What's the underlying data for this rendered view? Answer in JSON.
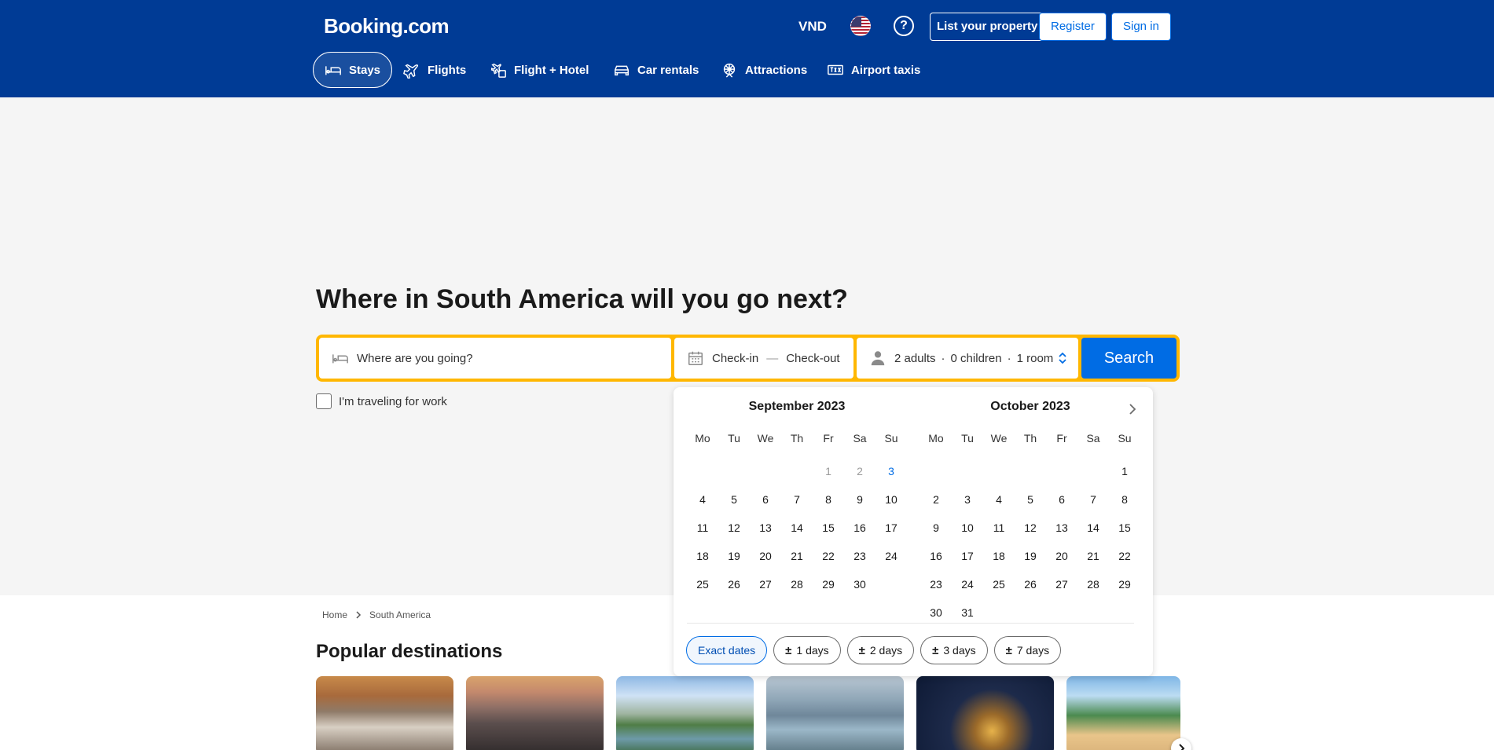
{
  "header": {
    "logo": "Booking.com",
    "currency": "VND",
    "help_symbol": "?",
    "list_property": "List your property",
    "register": "Register",
    "sign_in": "Sign in",
    "nav": [
      {
        "label": "Stays",
        "icon": "bed-icon",
        "active": true
      },
      {
        "label": "Flights",
        "icon": "plane-icon"
      },
      {
        "label": "Flight + Hotel",
        "icon": "flight-hotel-icon"
      },
      {
        "label": "Car rentals",
        "icon": "car-icon"
      },
      {
        "label": "Attractions",
        "icon": "attractions-icon"
      },
      {
        "label": "Airport taxis",
        "icon": "taxi-icon"
      }
    ]
  },
  "hero": {
    "headline": "Where in South America will you go next?"
  },
  "search": {
    "destination_placeholder": "Where are you going?",
    "checkin": "Check-in",
    "date_separator": "—",
    "checkout": "Check-out",
    "adults": "2 adults",
    "children": "0 children",
    "rooms": "1 room",
    "guest_separator": "·",
    "search_button": "Search",
    "work_label": "I'm traveling for work"
  },
  "calendar": {
    "weekdays": [
      "Mo",
      "Tu",
      "We",
      "Th",
      "Fr",
      "Sa",
      "Su"
    ],
    "months": [
      {
        "title": "September 2023",
        "leading_blanks": 4,
        "days": [
          "1",
          "2",
          "3",
          "4",
          "5",
          "6",
          "7",
          "8",
          "9",
          "10",
          "11",
          "12",
          "13",
          "14",
          "15",
          "16",
          "17",
          "18",
          "19",
          "20",
          "21",
          "22",
          "23",
          "24",
          "25",
          "26",
          "27",
          "28",
          "29",
          "30"
        ],
        "past_days": [
          "1",
          "2"
        ],
        "today": "3"
      },
      {
        "title": "October 2023",
        "leading_blanks": 6,
        "days": [
          "1",
          "2",
          "3",
          "4",
          "5",
          "6",
          "7",
          "8",
          "9",
          "10",
          "11",
          "12",
          "13",
          "14",
          "15",
          "16",
          "17",
          "18",
          "19",
          "20",
          "21",
          "22",
          "23",
          "24",
          "25",
          "26",
          "27",
          "28",
          "29",
          "30",
          "31"
        ],
        "past_days": [],
        "today": ""
      }
    ],
    "flex_options": [
      {
        "label": "Exact dates",
        "active": true
      },
      {
        "label": "1 days",
        "prefix": "±"
      },
      {
        "label": "2 days",
        "prefix": "±"
      },
      {
        "label": "3 days",
        "prefix": "±"
      },
      {
        "label": "7 days",
        "prefix": "±"
      }
    ]
  },
  "breadcrumb": {
    "home": "Home",
    "current": "South America"
  },
  "popular": {
    "title": "Popular destinations"
  },
  "colors": {
    "brand_blue": "#003b95",
    "accent_blue": "#006ce4",
    "search_border": "#ffb700"
  }
}
